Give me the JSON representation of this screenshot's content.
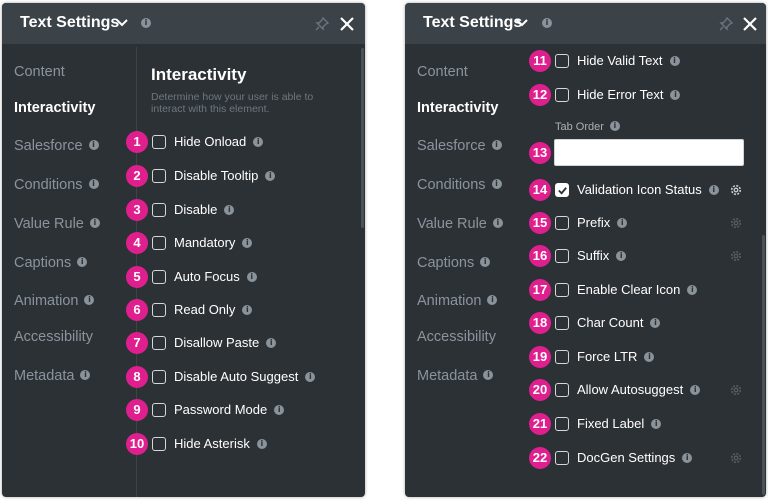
{
  "header": {
    "title": "Text Settings"
  },
  "nav": [
    "Content",
    "Interactivity",
    "Salesforce",
    "Conditions",
    "Value Rule",
    "Captions",
    "Animation",
    "Accessibility",
    "Metadata"
  ],
  "section": {
    "title": "Interactivity",
    "description": "Determine how your user is able to interact with this element."
  },
  "tab_order": {
    "label": "Tab Order",
    "value": ""
  },
  "left_items": [
    {
      "badge": "1",
      "label": "Hide Onload"
    },
    {
      "badge": "2",
      "label": "Disable Tooltip"
    },
    {
      "badge": "3",
      "label": "Disable"
    },
    {
      "badge": "4",
      "label": "Mandatory"
    },
    {
      "badge": "5",
      "label": "Auto Focus"
    },
    {
      "badge": "6",
      "label": "Read Only"
    },
    {
      "badge": "7",
      "label": "Disallow Paste"
    },
    {
      "badge": "8",
      "label": "Disable Auto Suggest"
    },
    {
      "badge": "9",
      "label": "Password Mode"
    },
    {
      "badge": "10",
      "label": "Hide Asterisk"
    }
  ],
  "right_items": [
    {
      "badge": "11",
      "label": "Hide Valid Text",
      "checked": false
    },
    {
      "badge": "12",
      "label": "Hide Error Text",
      "checked": false
    },
    {
      "badge": "14",
      "label": "Validation Icon Status",
      "checked": true
    },
    {
      "badge": "15",
      "label": "Prefix",
      "checked": false
    },
    {
      "badge": "16",
      "label": "Suffix",
      "checked": false
    },
    {
      "badge": "17",
      "label": "Enable Clear Icon",
      "checked": false
    },
    {
      "badge": "18",
      "label": "Char Count",
      "checked": false
    },
    {
      "badge": "19",
      "label": "Force LTR",
      "checked": false
    },
    {
      "badge": "20",
      "label": "Allow Autosuggest",
      "checked": false
    },
    {
      "badge": "21",
      "label": "Fixed Label",
      "checked": false
    },
    {
      "badge": "22",
      "label": "DocGen Settings",
      "checked": false
    }
  ],
  "tab_order_badge": "13",
  "icons": {
    "info": "info-icon",
    "chevron": "chevron-down-icon",
    "pin": "pin-icon",
    "close": "close-icon",
    "gear": "gear-icon",
    "check": "check-icon"
  },
  "colors": {
    "panel_bg": "#2c3136",
    "header_bg": "#3b4349",
    "badge": "#e01f8e",
    "text": "#ffffff",
    "muted": "#8b949c"
  }
}
